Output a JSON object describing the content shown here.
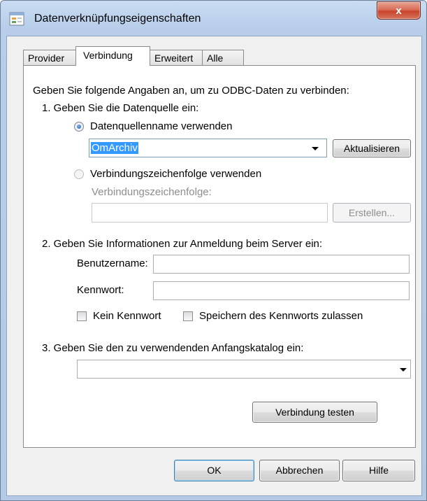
{
  "window": {
    "title": "Datenverknüpfungseigenschaften",
    "close_label": "x",
    "icon": "data-link-icon"
  },
  "tabs": [
    {
      "label": "Provider",
      "active": false
    },
    {
      "label": "Verbindung",
      "active": true
    },
    {
      "label": "Erweitert",
      "active": false
    },
    {
      "label": "Alle",
      "active": false
    }
  ],
  "connection": {
    "intro": "Geben Sie folgende Angaben an, um zu ODBC-Daten zu verbinden:",
    "step1": "1. Geben Sie die Datenquelle ein:",
    "radio_dsn": "Datenquellenname verwenden",
    "dsn_value": "OmArchiv",
    "refresh_button": "Aktualisieren",
    "radio_connstring": "Verbindungszeichenfolge verwenden",
    "connstring_label": "Verbindungszeichenfolge:",
    "connstring_value": "",
    "build_button": "Erstellen...",
    "step2": "2. Geben Sie Informationen zur Anmeldung beim Server ein:",
    "username_label": "Benutzername:",
    "username_value": "",
    "password_label": "Kennwort:",
    "password_value": "",
    "no_password": "Kein Kennwort",
    "allow_saving": "Speichern des Kennworts zulassen",
    "step3": "3. Geben Sie den zu verwendenden Anfangskatalog ein:",
    "catalog_value": "",
    "test_button": "Verbindung testen"
  },
  "footer": {
    "ok": "OK",
    "cancel": "Abbrechen",
    "help": "Hilfe"
  }
}
